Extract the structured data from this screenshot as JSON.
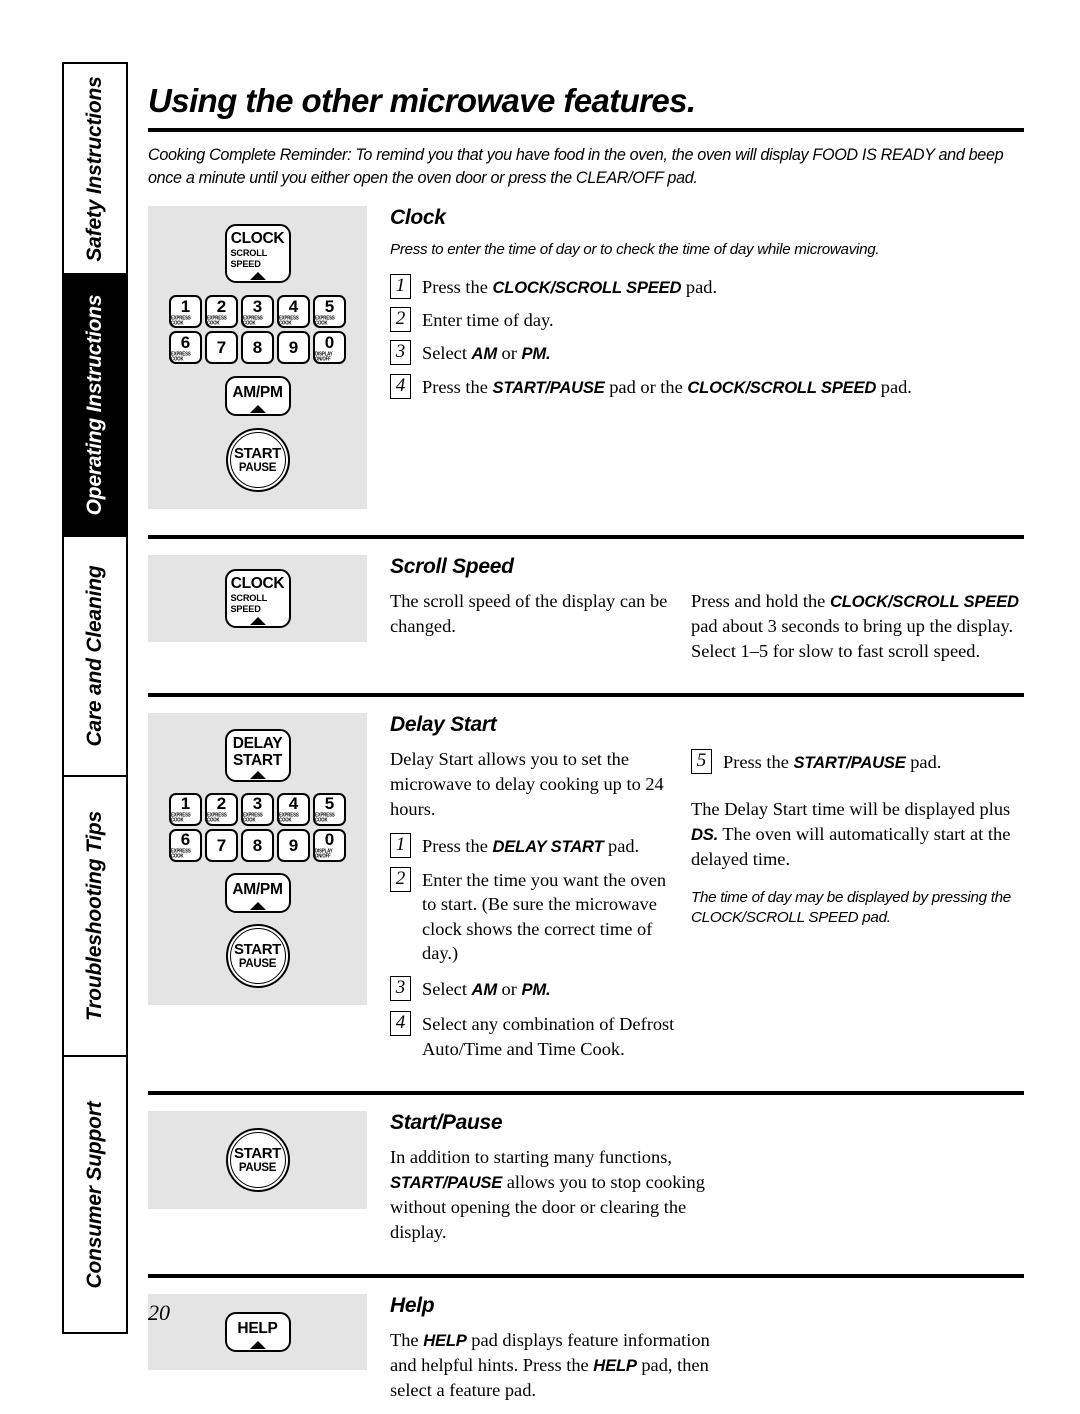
{
  "sidebar": {
    "tabs": [
      {
        "label": "Safety Instructions",
        "active": false
      },
      {
        "label": "Operating Instructions",
        "active": true
      },
      {
        "label": "Care and Cleaning",
        "active": false
      },
      {
        "label": "Troubleshooting Tips",
        "active": false
      },
      {
        "label": "Consumer Support",
        "active": false
      }
    ]
  },
  "header": {
    "title": "Using the other microwave features.",
    "reminder": "Cooking Complete Reminder: To remind you that you have food in the oven, the oven will display FOOD IS READY and beep once a minute until you either open the oven door or press the CLEAR/OFF pad."
  },
  "pads": {
    "clock": {
      "line1": "CLOCK",
      "line2": "SCROLL SPEED"
    },
    "delay_start": {
      "line1": "DELAY",
      "line2": "START"
    },
    "ampm": {
      "line1": "AM/PM",
      "line2": ""
    },
    "help": {
      "line1": "HELP",
      "line2": ""
    },
    "start_pause": {
      "line1": "START",
      "line2": "PAUSE"
    },
    "keys_row1": [
      {
        "digit": "1",
        "sub": "EXPRESS COOK"
      },
      {
        "digit": "2",
        "sub": "EXPRESS COOK"
      },
      {
        "digit": "3",
        "sub": "EXPRESS COOK"
      },
      {
        "digit": "4",
        "sub": "EXPRESS COOK"
      },
      {
        "digit": "5",
        "sub": "EXPRESS COOK"
      }
    ],
    "keys_row2": [
      {
        "digit": "6",
        "sub": "EXPRESS COOK"
      },
      {
        "digit": "7",
        "sub": ""
      },
      {
        "digit": "8",
        "sub": ""
      },
      {
        "digit": "9",
        "sub": ""
      },
      {
        "digit": "0",
        "sub": "DISPLAY ON/OFF"
      }
    ]
  },
  "sections": {
    "clock": {
      "heading": "Clock",
      "intro": "Press to enter the time of day or to check the time of day while microwaving.",
      "steps": [
        {
          "num": "1",
          "pre": "Press the ",
          "kw": "CLOCK/SCROLL SPEED",
          "post": " pad.",
          "kw2": "",
          "post2": ""
        },
        {
          "num": "2",
          "pre": "Enter time of day.",
          "kw": "",
          "post": "",
          "kw2": "",
          "post2": ""
        },
        {
          "num": "3",
          "pre": "Select ",
          "kw": "AM",
          "post": " or ",
          "kw2": "PM.",
          "post2": ""
        },
        {
          "num": "4",
          "pre": "Press the ",
          "kw": "START/PAUSE",
          "post": " pad or the ",
          "kw2": "CLOCK/SCROLL SPEED",
          "post2": " pad."
        }
      ]
    },
    "scroll_speed": {
      "heading": "Scroll Speed",
      "left_text": "The scroll speed of the display can be changed.",
      "right_pre": "Press and hold the ",
      "right_kw": "CLOCK/SCROLL SPEED",
      "right_post": " pad about 3 seconds to bring up the display. Select 1–5 for slow to fast scroll speed."
    },
    "delay_start": {
      "heading": "Delay Start",
      "intro": "Delay Start allows you to set the microwave to delay cooking up to 24 hours.",
      "steps": [
        {
          "num": "1",
          "pre": "Press the ",
          "kw": "DELAY START",
          "post": " pad.",
          "kw2": "",
          "post2": ""
        },
        {
          "num": "2",
          "pre": "Enter the time you want the oven to start. (Be sure the microwave clock shows the correct time of day.)",
          "kw": "",
          "post": "",
          "kw2": "",
          "post2": ""
        },
        {
          "num": "3",
          "pre": "Select ",
          "kw": "AM",
          "post": " or ",
          "kw2": "PM.",
          "post2": ""
        },
        {
          "num": "4",
          "pre": "Select any combination of Defrost Auto/Time  and Time Cook.",
          "kw": "",
          "post": "",
          "kw2": "",
          "post2": ""
        }
      ],
      "step5": {
        "num": "5",
        "pre": "Press the ",
        "kw": "START/PAUSE",
        "post": " pad."
      },
      "note_pre": "The Delay Start  time will be displayed plus ",
      "note_kw": "DS.",
      "note_post": "  The oven will automatically start at the delayed time.",
      "italic_note": "The time of day may be displayed by pressing the CLOCK/SCROLL SPEED pad."
    },
    "start_pause": {
      "heading": "Start/Pause",
      "pre": "In addition to starting many functions, ",
      "kw": "START/PAUSE",
      "post": " allows you to stop cooking without opening the door or clearing the display."
    },
    "help": {
      "heading": "Help",
      "pre": "The ",
      "kw": "HELP",
      "mid": " pad displays feature information and helpful hints. Press the ",
      "kw2": "HELP",
      "post": " pad, then select a feature pad."
    }
  },
  "footer": {
    "page_number": "20"
  },
  "colors": {
    "panel_bg": "#e4e4e4",
    "ink": "#000000",
    "paper": "#ffffff"
  }
}
